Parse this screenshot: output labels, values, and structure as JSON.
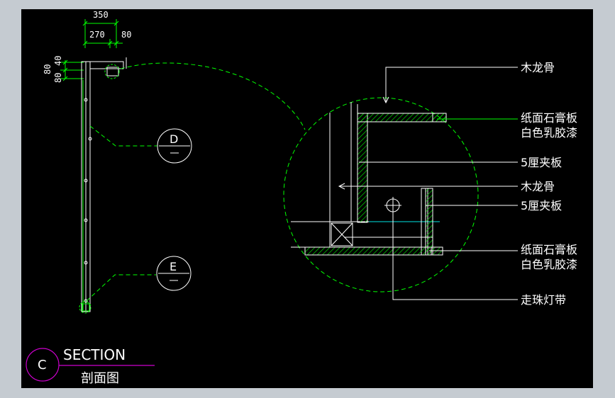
{
  "dimensions": {
    "overall_width": "350",
    "part_a": "270",
    "part_b": "80",
    "vertical": [
      "80",
      "80",
      "40"
    ]
  },
  "callouts": {
    "d_letter": "D",
    "e_letter": "E"
  },
  "labels": {
    "wood_keel_top": "木龙骨",
    "gypsum_board_top": "纸面石膏板",
    "white_latex_top": "白色乳胶漆",
    "plywood_1": "5厘夹板",
    "wood_keel_2": "木龙骨",
    "plywood_2": "5厘夹板",
    "gypsum_board_bottom": "纸面石膏板",
    "white_latex_bottom": "白色乳胶漆",
    "led_strip": "走珠灯带"
  },
  "title_block": {
    "letter": "C",
    "title": "SECTION",
    "subtitle": "剖面图"
  },
  "colors": {
    "background": "#000000",
    "frame": "#c5cbd1",
    "line": "#ffffff",
    "dimension": "#00ff00",
    "hatch": "#00cc00",
    "leader": "#00ff00",
    "title_circle": "#cc00cc",
    "cyan": "#00e5e5"
  }
}
